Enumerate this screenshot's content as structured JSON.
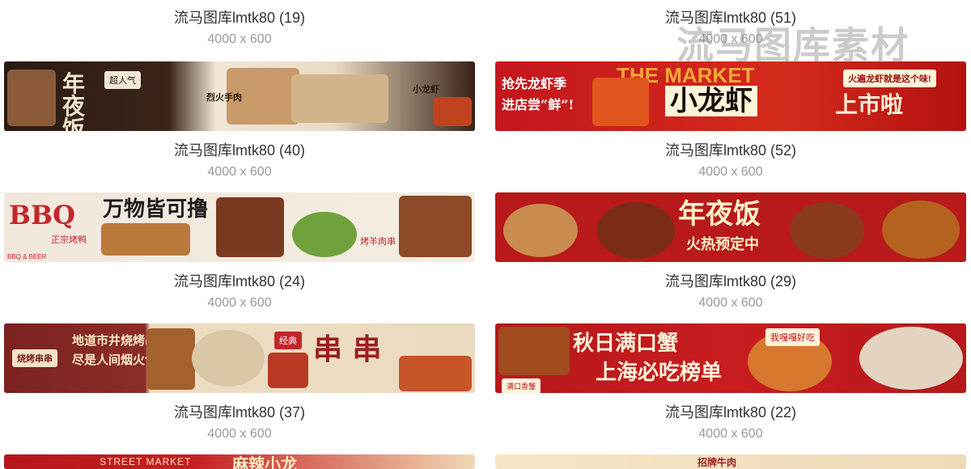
{
  "watermark": "流马图库素材",
  "items": [
    {
      "name": "流马图库lmtk80 (19)",
      "dims": "4000 x 600"
    },
    {
      "name": "流马图库lmtk80 (51)",
      "dims": "4000 x 600"
    },
    {
      "name": "流马图库lmtk80 (40)",
      "dims": "4000 x 600"
    },
    {
      "name": "流马图库lmtk80 (52)",
      "dims": "4000 x 600"
    },
    {
      "name": "流马图库lmtk80 (24)",
      "dims": "4000 x 600"
    },
    {
      "name": "流马图库lmtk80 (29)",
      "dims": "4000 x 600"
    },
    {
      "name": "流马图库lmtk80 (37)",
      "dims": "4000 x 600"
    },
    {
      "name": "流马图库lmtk80 (22)",
      "dims": "4000 x 600"
    }
  ],
  "banners": {
    "nianyefan1": {
      "title": "年夜饭",
      "tag1": "超人气",
      "tag2": "烈火手肉",
      "tag3": "小龙虾"
    },
    "longxia": {
      "slogan1": "抢先龙虾季",
      "slogan2": "进店尝“鲜”!",
      "title": "小龙虾",
      "title2": "上市啦",
      "badge": "THE MARKET",
      "tag": "火遍龙虾就是这个味!"
    },
    "bbq": {
      "logo": "BBQ",
      "title": "万物皆可撸",
      "tag1": "正宗烤鸭",
      "tag2": "烤羊肉串",
      "foot": "BBQ & BEER"
    },
    "nianyefan2": {
      "title": "年夜饭",
      "sub": "火热预定中"
    },
    "chuanchuan": {
      "logo": "烧烤串串",
      "line1": "地道市井烧烤串",
      "line2": "尽是人间烟火气",
      "title": "串 串",
      "tag": "经典"
    },
    "xie": {
      "line1": "秋日满口蟹",
      "line2": "上海必吃榜单",
      "tag": "我嘎嘎好吃",
      "foot": "满口香蟹"
    },
    "street": {
      "text": "STREET MARKET",
      "title": "麻辣小龙"
    },
    "niurou": {
      "text": "招牌牛肉"
    }
  }
}
